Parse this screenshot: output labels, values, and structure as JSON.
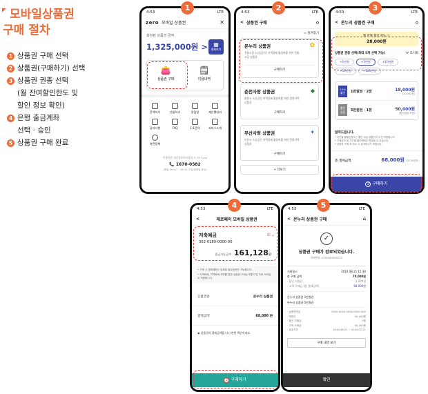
{
  "title": {
    "line1": "모바일상품권",
    "line2": "구매 절차"
  },
  "steps": [
    {
      "num": "1",
      "text": "상품권 구매 선택"
    },
    {
      "num": "2",
      "text": "상품권(구매하기) 선택"
    },
    {
      "num": "3",
      "text": "상품권 권종 선택"
    },
    {
      "num": "",
      "text": "(월 잔여할인한도 및"
    },
    {
      "num": "",
      "text": "할인 정보 확인)"
    },
    {
      "num": "4",
      "text": "은행 출금계좌"
    },
    {
      "num": "",
      "text": "선택 · 승인"
    },
    {
      "num": "5",
      "text": "상품권 구매 완료"
    }
  ],
  "status": {
    "time": "4:53",
    "signal": "LTE"
  },
  "screen1": {
    "app_title": "모바일 상품권",
    "logo": "zero",
    "balance_label": "충전된 상품권 금액",
    "balance": "1,325,000원 >",
    "qr_label": "결제하기",
    "menu": [
      {
        "label": "상품권 구매"
      },
      {
        "label": "이용내역"
      }
    ],
    "grid": [
      "잔액하기",
      "선물하기",
      "정립맞",
      "계산됐내리",
      "공지사항",
      "FAQ",
      "1:1문의",
      "서비스소개",
      "약관정책"
    ],
    "footer_links": "이용약관   개인정보처리방침   © KT Corp",
    "phone": "1670-0582",
    "footer_note": "(평일 09:00 ~ 18:00, 주말/공휴일 휴무)"
  },
  "screen2": {
    "header": "상품권 구매",
    "fav": "즐겨찾기",
    "cards": [
      {
        "name": "온누리 상품권",
        "desc": "전통시장 소상공인의 지역경제 활성화를 위한 전통시장 상품권",
        "btn": "구매하기"
      },
      {
        "name": "춘천사랑 상품권",
        "desc": "춘천시 소상공인 지역경제 활성화를 위한 전용지역 상품권",
        "btn": "구매하기"
      },
      {
        "name": "부산사랑 상품권",
        "desc": "부산시 소상공인 지역경제 활성화를 위한 전용지역 상품권",
        "btn": "구매하기"
      }
    ],
    "more": "+ 더보기"
  },
  "screen3": {
    "header": "온누리 상품권 구매",
    "limit_label": "월 잔여 할인 한도 ⓘ",
    "limit_value": "28,000원",
    "select_label": "상품권 권종 선택(최대 5개 선택 가능)",
    "reset": "초기화",
    "chips": [
      "+1만원",
      "+5만원",
      "+10만원",
      "+50만원",
      "+100만원"
    ],
    "rows": [
      {
        "tag": "10%",
        "tag2": "할인",
        "label": "1만원권 · 2장",
        "amount": "18,000원",
        "sub": "(20,000원)"
      },
      {
        "tag": "할인",
        "tag2": "없음",
        "label": "5만원권 · 1장",
        "amount": "50,000원",
        "sub": "(할인없음 포함)"
      }
    ],
    "notice_title": "알려드립니다.",
    "notice": [
      "* 개인별 월할인한도는 할인 대상 상품권이 우선 적용됩니다.",
      "* 구매금액 및 기간별 할인혜택은 변경될 수 있습니다.",
      "* 상품권 구매 후 취소 시 유의하시기 바랍니다."
    ],
    "total_label": "총 결제금액",
    "total_value": "68,000원",
    "total_sub": "(78,000원)",
    "buy": "구매하기"
  },
  "screen4": {
    "header": "제로페이 모바일 상품권",
    "bank": "저축예금",
    "account": "302-0189-0000-00",
    "avail_label": "출금가능금액",
    "avail": "161,128",
    "avail_unit": "원",
    "notes": [
      "• 구매 시 결제계좌는 등록된 출금계좌만 가능합니다.",
      "• 지역화폐, 지역화폐 계좌를 통한 상품권 구매는 8월22일 이후 모바일로 적용됩니다."
    ],
    "product_label": "상품권명",
    "product_value": "온누리 상품권",
    "pay_label": "결제금액",
    "pay_value": "68,000 원",
    "agree": "상품권의 결제금액을 다시 한번 확인하세요.",
    "buy": "구매하기"
  },
  "screen5": {
    "header": "온누리 상품권 구매",
    "done": "상품권 구매가 완료되었습니다.",
    "txn": "거래번호 1234567890123",
    "rows": [
      {
        "k": "거래일시",
        "v": "2019.08.21 15:30"
      },
      {
        "k": "총 구매 금액",
        "v": "70,000원"
      },
      {
        "k": "· 할인 지원금",
        "v": "2,000원"
      },
      {
        "k": "· 고객 구매금 (총 결제금액)",
        "v": "68,000원"
      }
    ],
    "items": [
      {
        "k": "온누리 상품권 1만원권",
        "v": ""
      },
      {
        "k": "온누리 상품권 5만원권",
        "v": ""
      }
    ],
    "detail": [
      {
        "k": "· 상품권번호",
        "v": "0000-0000-0000-0000-000"
      },
      {
        "k": "· 액면가",
        "v": "50,000원"
      },
      {
        "k": "· 할인 지원금",
        "v": "0원"
      },
      {
        "k": "· 고객 구매금",
        "v": "50,000원"
      },
      {
        "k": "· 유효기간",
        "v": "2019.08.01 ~ 2024.07.31"
      }
    ],
    "history": "구매 내역 보기",
    "confirm": "확인"
  }
}
